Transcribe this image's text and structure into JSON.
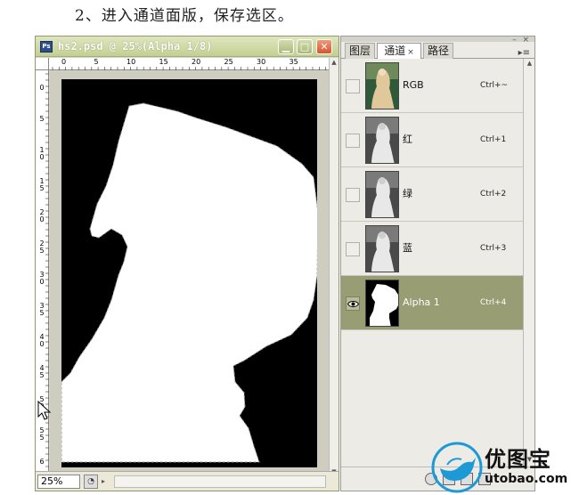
{
  "heading": "2、进入通道面版，保存选区。",
  "document": {
    "title": "hs2.psd @ 25%(Alpha 1/8)",
    "app_icon": "Ps",
    "zoom": "25%",
    "ruler_top": [
      "0",
      "5",
      "10",
      "15",
      "20",
      "25",
      "30",
      "35"
    ],
    "ruler_left": [
      "0",
      "5",
      "10",
      "15",
      "20",
      "25",
      "30",
      "35",
      "40",
      "45",
      "50",
      "55",
      "6"
    ]
  },
  "panel": {
    "tabs": [
      "图层",
      "通道",
      "路径"
    ],
    "active_tab": "通道",
    "channels": [
      {
        "name": "RGB",
        "shortcut": "Ctrl+~",
        "visible": false,
        "active": false,
        "thumb": "color"
      },
      {
        "name": "红",
        "shortcut": "Ctrl+1",
        "visible": false,
        "active": false,
        "thumb": "gray"
      },
      {
        "name": "绿",
        "shortcut": "Ctrl+2",
        "visible": false,
        "active": false,
        "thumb": "gray"
      },
      {
        "name": "蓝",
        "shortcut": "Ctrl+3",
        "visible": false,
        "active": false,
        "thumb": "gray"
      },
      {
        "name": "Alpha 1",
        "shortcut": "Ctrl+4",
        "visible": true,
        "active": true,
        "thumb": "mask"
      }
    ]
  },
  "watermark": {
    "brand": "优图宝",
    "url": "utobao.com"
  },
  "colors": {
    "titlebar": "#c3cf92",
    "active_row": "#989d73",
    "canvas_bg": "#000000",
    "mask_fill": "#ffffff",
    "watermark_blue": "#1d9ad6"
  }
}
